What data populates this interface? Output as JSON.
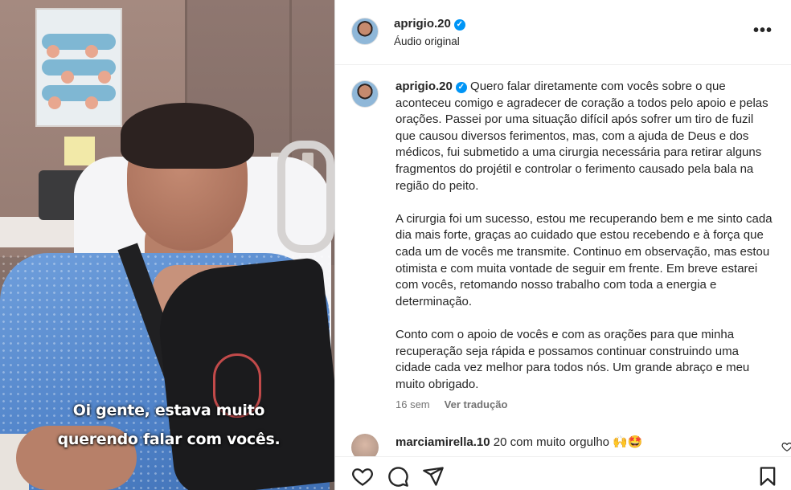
{
  "video": {
    "subtitle_line1": "Oi gente, estava muito",
    "subtitle_line2": "querendo falar com vocês."
  },
  "header": {
    "username": "aprigio.20",
    "verified": true,
    "audio_label": "Áudio original",
    "more_icon": "more-options-icon"
  },
  "post": {
    "username": "aprigio.20",
    "paragraphs": [
      "Quero falar diretamente com vocês sobre o que aconteceu comigo e agradecer de coração a todos pelo apoio e pelas orações. Passei por uma situação difícil após sofrer um tiro de fuzil que causou diversos ferimentos, mas, com a ajuda de Deus e dos médicos, fui submetido a uma cirurgia necessária para retirar alguns fragmentos do projétil e controlar o ferimento causado pela bala na região do peito.",
      "A cirurgia foi um sucesso, estou me recuperando bem e me sinto cada dia mais forte, graças ao cuidado que estou recebendo e à força que cada um de vocês me transmite. Continuo em observação, mas estou otimista e com muita vontade de seguir em frente. Em breve estarei com vocês, retomando nosso trabalho com toda a energia e determinação.",
      "Conto com o apoio de vocês e com as orações para que minha recuperação seja rápida e possamos continuar construindo uma cidade cada vez melhor para todos nós. Um grande abraço e meu muito obrigado."
    ],
    "time_ago": "16 sem",
    "translate_label": "Ver tradução"
  },
  "comment": {
    "username": "marciamirella.10",
    "text": "20 com muito orgulho",
    "emojis": "🙌🤩"
  },
  "colors": {
    "verified_blue": "#0095f6",
    "text_primary": "#262626",
    "text_secondary": "#737373"
  },
  "actions": [
    "like-icon",
    "comment-icon",
    "share-icon",
    "save-icon"
  ]
}
